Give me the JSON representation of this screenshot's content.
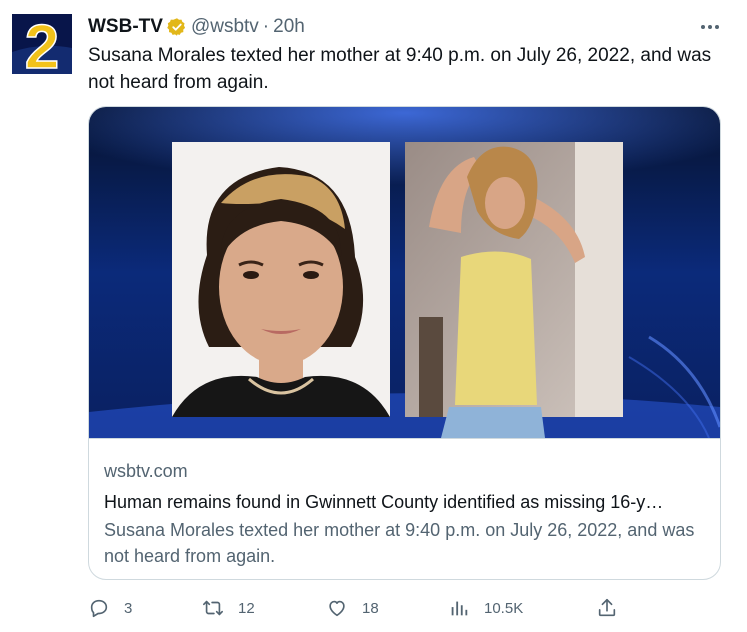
{
  "author": {
    "name": "WSB-TV",
    "handle": "@wsbtv",
    "separator": "·",
    "time": "20h",
    "avatar_text": "2",
    "verified_icon": "verified-badge-icon"
  },
  "tweet": {
    "text": "Susana Morales texted her mother at 9:40 p.m. on July 26, 2022, and was not heard from again."
  },
  "card": {
    "domain": "wsbtv.com",
    "title": "Human remains found in Gwinnett County identified as missing 16-y…",
    "description": "Susana Morales texted her mother at 9:40 p.m. on July 26, 2022, and was not heard from again."
  },
  "actions": {
    "reply_count": "3",
    "retweet_count": "12",
    "like_count": "18",
    "views_count": "10.5K"
  },
  "colors": {
    "text_primary": "#0f1419",
    "text_secondary": "#536471",
    "border": "#cfd9de",
    "verified_gold": "#e2b719",
    "avatar_blue": "#08154a",
    "avatar_yellow": "#f2c21b"
  }
}
